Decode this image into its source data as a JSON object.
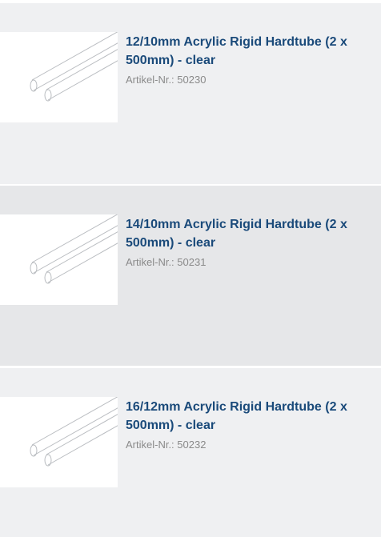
{
  "products": [
    {
      "title": "12/10mm Acrylic Rigid Hardtube (2 x 500mm) - clear",
      "sku": "Artikel-Nr.: 50230",
      "image_icon": "acrylic-tubes-image"
    },
    {
      "title": "14/10mm Acrylic Rigid Hardtube (2 x 500mm) - clear",
      "sku": "Artikel-Nr.: 50231",
      "image_icon": "acrylic-tubes-image"
    },
    {
      "title": "16/12mm Acrylic Rigid Hardtube (2 x 500mm) - clear",
      "sku": "Artikel-Nr.: 50232",
      "image_icon": "acrylic-tubes-image"
    }
  ],
  "colors": {
    "title": "#1a4a7a",
    "sku": "#8a8a8a",
    "row_light": "#eff0f2",
    "row_dark": "#e6e7e9"
  }
}
